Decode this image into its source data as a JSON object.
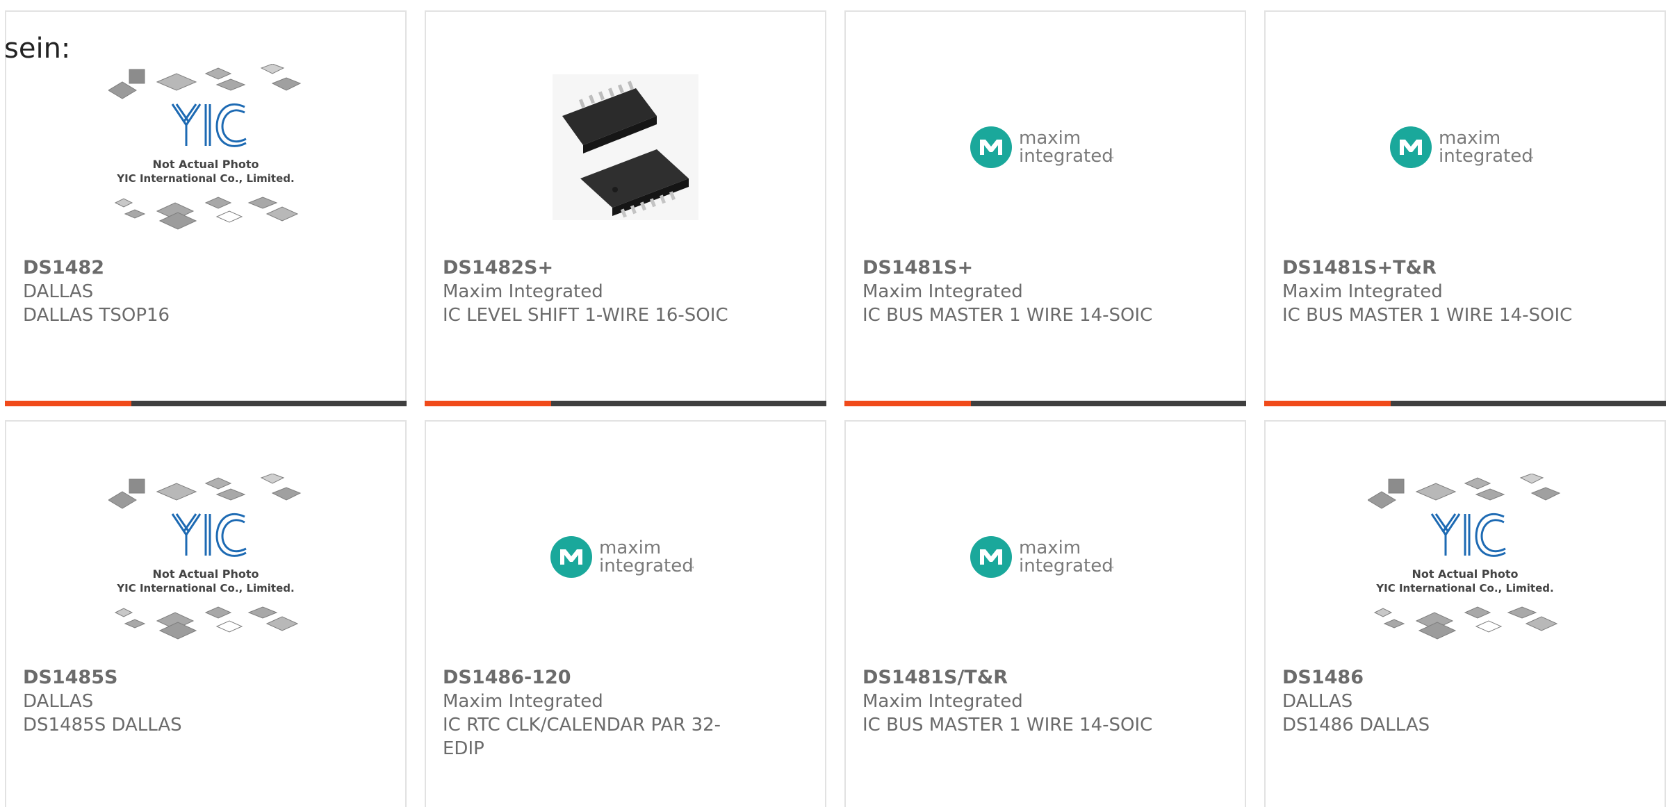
{
  "intro_text": "sein:",
  "colors": {
    "accent_bar": "#f04a1a",
    "dark_bar": "#3f3f3f",
    "card_border": "#e2e2e2",
    "text_gray": "#6b6b6b",
    "maxim_teal": "#1aa89b",
    "yic_blue": "#1d6ab3"
  },
  "placeholder_caption": {
    "line1": "Not Actual Photo",
    "line2": "YIC International Co., Limited."
  },
  "maxim_logo": {
    "word1": "maxim",
    "word2": "integrated",
    "tm": "™"
  },
  "products": [
    {
      "part_no": "DS1482",
      "manufacturer": "DALLAS",
      "description": "DALLAS TSOP16",
      "image": "yic-placeholder"
    },
    {
      "part_no": "DS1482S+",
      "manufacturer": "Maxim Integrated",
      "description": "IC LEVEL SHIFT 1-WIRE 16-SOIC",
      "image": "soic-chip-photo"
    },
    {
      "part_no": "DS1481S+",
      "manufacturer": "Maxim Integrated",
      "description": "IC BUS MASTER 1 WIRE 14-SOIC",
      "image": "maxim-logo"
    },
    {
      "part_no": "DS1481S+T&R",
      "manufacturer": "Maxim Integrated",
      "description": "IC BUS MASTER 1 WIRE 14-SOIC",
      "image": "maxim-logo"
    },
    {
      "part_no": "DS1485S",
      "manufacturer": "DALLAS",
      "description": "DS1485S DALLAS",
      "image": "yic-placeholder"
    },
    {
      "part_no": "DS1486-120",
      "manufacturer": "Maxim Integrated",
      "description": "IC RTC CLK/CALENDAR PAR 32-EDIP",
      "image": "maxim-logo"
    },
    {
      "part_no": "DS1481S/T&R",
      "manufacturer": "Maxim Integrated",
      "description": "IC BUS MASTER 1 WIRE 14-SOIC",
      "image": "maxim-logo"
    },
    {
      "part_no": "DS1486",
      "manufacturer": "DALLAS",
      "description": "DS1486 DALLAS",
      "image": "yic-placeholder"
    }
  ]
}
